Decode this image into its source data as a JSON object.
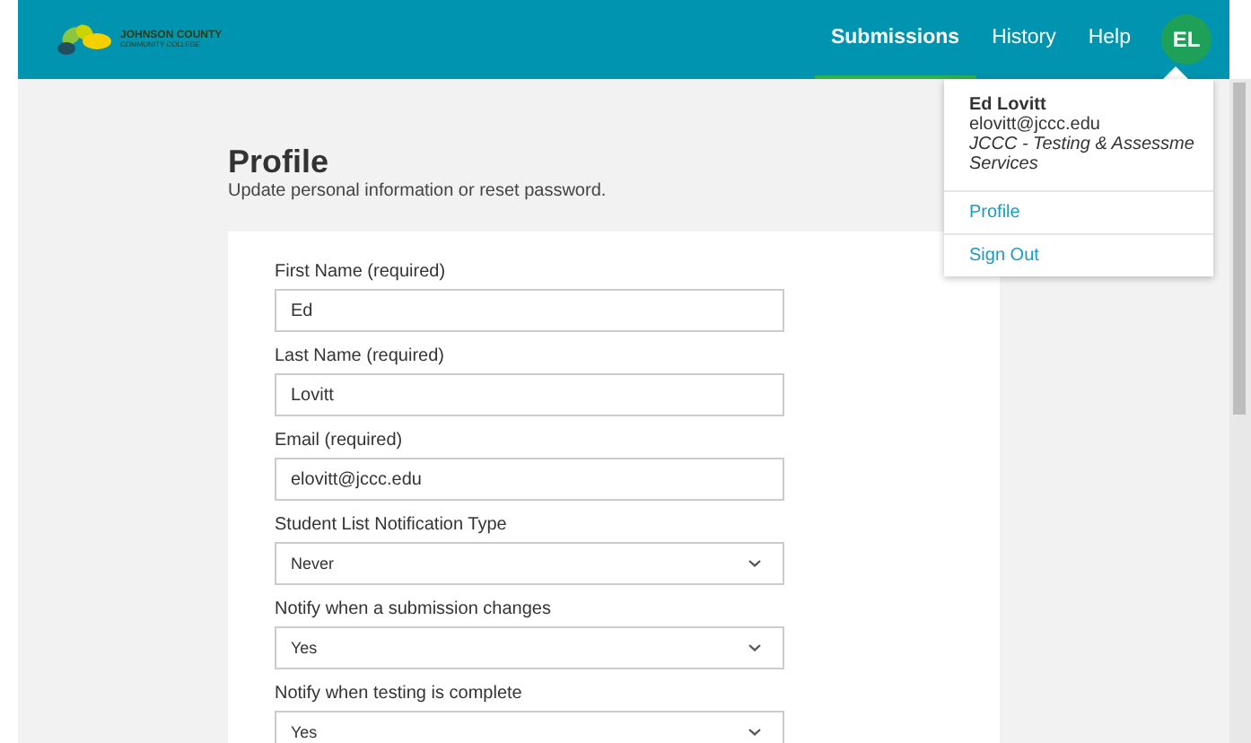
{
  "header": {
    "logo": {
      "line1": "JOHNSON COUNTY",
      "line2": "COMMUNITY COLLEGE"
    },
    "nav": [
      {
        "label": "Submissions",
        "selected": true
      },
      {
        "label": "History",
        "selected": false
      },
      {
        "label": "Help",
        "selected": false
      }
    ],
    "avatar": "EL"
  },
  "user_menu": {
    "name": "Ed Lovitt",
    "email": "elovitt@jccc.edu",
    "department": [
      "JCCC - Testing & Assessme",
      "Services"
    ],
    "items": [
      "Profile",
      "Sign Out"
    ]
  },
  "page": {
    "title": "Profile",
    "subtitle": "Update personal information or reset password."
  },
  "fields": [
    {
      "kind": "text",
      "label": "First Name (required)",
      "value": "Ed"
    },
    {
      "kind": "text",
      "label": "Last Name (required)",
      "value": "Lovitt"
    },
    {
      "kind": "text",
      "label": "Email (required)",
      "value": "elovitt@jccc.edu"
    },
    {
      "kind": "select",
      "label": "Student List Notification Type",
      "value": "Never"
    },
    {
      "kind": "select",
      "label": "Notify when a submission changes",
      "value": "Yes"
    },
    {
      "kind": "select",
      "label": "Notify when testing is complete",
      "value": "Yes"
    }
  ]
}
